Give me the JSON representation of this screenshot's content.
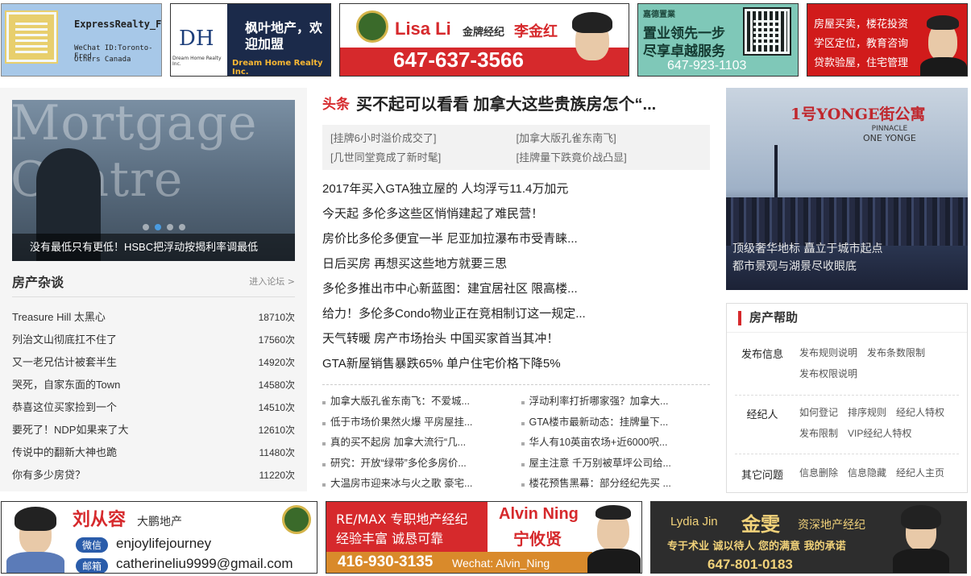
{
  "top_ads": [
    {
      "name": "ExpressRealty_Fred",
      "line2": "WeChat ID:Toronto-Fred",
      "line3": "Others Canada"
    },
    {
      "name": "枫叶地产，欢迎加盟",
      "line2": "Dream Home Realty Inc.",
      "logo": "DH",
      "logo_sub": "Dream Home Realty Inc."
    },
    {
      "name": "Lisa Li",
      "title": "金牌经纪",
      "cn_name": "李金红",
      "phone": "647-637-3566"
    },
    {
      "name": "嘉德置業",
      "line1": "置业领先一步",
      "line2": "尽享卓越服务",
      "phone": "647-923-1103"
    },
    {
      "line1": "房屋买卖，楼花投资",
      "line2": "学区定位，教育咨询",
      "line3": "贷款验屋，住宅管理"
    }
  ],
  "slider": {
    "watermark": "Mortgage Centre",
    "caption": "没有最低只有更低！HSBC把浮动按揭利率调最低",
    "active_dot": 1
  },
  "forum": {
    "title": "房产杂谈",
    "more": "进入论坛 >",
    "items": [
      {
        "title": "Treasure Hill 太黑心",
        "count": "18710次"
      },
      {
        "title": "列治文山彻底扛不住了",
        "count": "17560次"
      },
      {
        "title": "又一老兄估计被套半生",
        "count": "14920次"
      },
      {
        "title": "哭死，自家东面的Town",
        "count": "14580次"
      },
      {
        "title": "恭喜这位买家捡到一个",
        "count": "14510次"
      },
      {
        "title": "要死了！NDP如果来了大",
        "count": "12610次"
      },
      {
        "title": "传说中的翻新大神也跪",
        "count": "11480次"
      },
      {
        "title": "你有多少房贷？",
        "count": "11220次"
      }
    ]
  },
  "headline": {
    "tag": "头条",
    "title": "买不起可以看看 加拿大这些贵族房怎个“..."
  },
  "sub_links": [
    "[挂牌6小时溢价成交了]",
    "[加拿大版孔雀东南飞]",
    "[几世同堂竟成了新时髦]",
    "[挂牌量下跌竟价战凸显]"
  ],
  "news": [
    "2017年买入GTA独立屋的 人均浮亏11.4万加元",
    "今天起 多伦多这些区悄悄建起了难民营！",
    "房价比多伦多便宜一半 尼亚加拉瀑布市受青睐...",
    "日后买房 再想买这些地方就要三思",
    "多伦多推出市中心新蓝图：建宜居社区 限高楼...",
    "给力！多伦多Condo物业正在竞相制订这一规定...",
    "天气转暖 房产市场抬头 中国买家首当其冲！",
    "GTA新屋销售暴跌65% 单户住宅价格下降5%"
  ],
  "small_news": [
    "加拿大版孔雀东南飞：不爱城...",
    "浮动利率打折哪家强？加拿大...",
    "低于市场价果然火爆 平房屋挂...",
    "GTA楼市最新动态：挂牌量下...",
    "真的买不起房 加拿大流行“几...",
    "华人有10英亩农场+近6000呎...",
    "研究：开放“绿带”多伦多房价...",
    "屋主注意 千万别被草坪公司给...",
    "大温房市迎来冰与火之歌 豪宅...",
    "楼花预售黑幕：部分经纪先买 ..."
  ],
  "right_banner": {
    "title": "1号YONGE街公寓",
    "brand": "PINNACLE",
    "brand2": "ONE YONGE",
    "slogan1": "顶级奢华地标 矗立于城市起点",
    "slogan2": "都市景观与湖景尽收眼底"
  },
  "help": {
    "title": "房产帮助",
    "rows": [
      {
        "label": "发布信息",
        "links": [
          "发布规则说明",
          "发布条数限制",
          "发布权限说明"
        ]
      },
      {
        "label": "经纪人",
        "links": [
          "如何登记",
          "排序规则",
          "经纪人特权",
          "发布限制",
          "VIP经纪人特权"
        ]
      },
      {
        "label": "其它问题",
        "links": [
          "信息删除",
          "信息隐藏",
          "经纪人主页"
        ]
      }
    ]
  },
  "bottom_ads": [
    {
      "name": "刘从容",
      "company": "大鹏地产",
      "wechat_label": "微信",
      "wechat": "enjoylifejourney",
      "mail_label": "邮箱",
      "email": "catherineliu9999@gmail.com"
    },
    {
      "line1": "RE/MAX 专职地产经纪",
      "line2": "经验丰富 诚恳可靠",
      "en_name": "Alvin Ning",
      "cn_name": "宁攸贤",
      "phone": "416-930-3135",
      "wechat": "Wechat: Alvin_Ning"
    },
    {
      "en_name": "Lydia  Jin",
      "cn_name": "金雯",
      "title": "资深地产经纪",
      "slogan": "专于术业  诚以待人  您的满意  我的承诺",
      "phone": "647-801-0183"
    }
  ]
}
